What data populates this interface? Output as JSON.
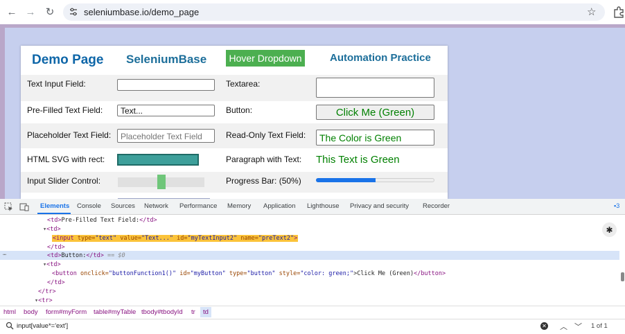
{
  "browser": {
    "url": "seleniumbase.io/demo_page",
    "back_icon": "←",
    "forward_icon": "→",
    "reload_icon": "↻",
    "star_icon": "☆"
  },
  "page": {
    "headers": {
      "demo": "Demo Page",
      "seleniumbase": "SeleniumBase",
      "hover": "Hover Dropdown",
      "automation": "Automation Practice"
    },
    "rows": {
      "text_input_label": "Text Input Field:",
      "textarea_label": "Textarea:",
      "prefilled_label": "Pre-Filled Text Field:",
      "prefilled_value": "Text...",
      "button_label": "Button:",
      "button_text": "Click Me (Green)",
      "placeholder_label": "Placeholder Text Field:",
      "placeholder_text": "Placeholder Text Field",
      "readonly_label": "Read-Only Text Field:",
      "readonly_value": "The Color is Green",
      "svg_label": "HTML SVG with rect:",
      "paragraph_label": "Paragraph with Text:",
      "paragraph_text": "This Text is Green",
      "slider_label": "Input Slider Control:",
      "progress_label": "Progress Bar: (50%)"
    },
    "progress_fraction": 0.5,
    "slider_fraction": 0.5,
    "colors": {
      "green": "#008000",
      "accent_blue": "#1c6e9a",
      "hover_green": "#4caf50",
      "svg_rect": "#3d9f9a"
    }
  },
  "devtools": {
    "tabs": [
      "Elements",
      "Console",
      "Sources",
      "Network",
      "Performance",
      "Memory",
      "Application",
      "Lighthouse",
      "Privacy and security",
      "Recorder"
    ],
    "issues_count": "3",
    "lines": {
      "l1_tag": "<td>",
      "l1_text": "Pre-Filled Text Field:",
      "l1_close": "</td>",
      "l2": "<td>",
      "l3_open": "<input ",
      "l3_type_attr": "type=",
      "l3_type_val": "\"text\"",
      "l3_value_attr": " value=",
      "l3_value_val": "\"Text...\"",
      "l3_id_attr": " id=",
      "l3_id_val": "\"myTextInput2\"",
      "l3_name_attr": " name=",
      "l3_name_val": "\"preText2\"",
      "l3_close": ">",
      "l4": "</td>",
      "l5_tag": "<td>",
      "l5_text": "Button:",
      "l5_close": "</td>",
      "l5_suffix": " == $0",
      "l6": "<td>",
      "l7_open": "<button ",
      "l7_onclick_attr": "onclick=",
      "l7_onclick_val": "\"buttonFunction1()\"",
      "l7_id_attr": " id=",
      "l7_id_val": "\"myButton\"",
      "l7_type_attr": " type=",
      "l7_type_val": "\"button\"",
      "l7_style_attr": " style=",
      "l7_style_val": "\"color: green;\"",
      "l7_text": ">Click Me (Green)",
      "l7_close": "</button>",
      "l8": "</td>",
      "l9": "</tr>",
      "l10": "<tr>"
    },
    "breadcrumbs": [
      "html",
      "body",
      "form#myForm",
      "table#myTable",
      "tbody#tbodyId",
      "tr",
      "td"
    ],
    "search_query": "input[value*='ext']",
    "search_result": "1 of 1",
    "cancel_label": "Cancel"
  }
}
